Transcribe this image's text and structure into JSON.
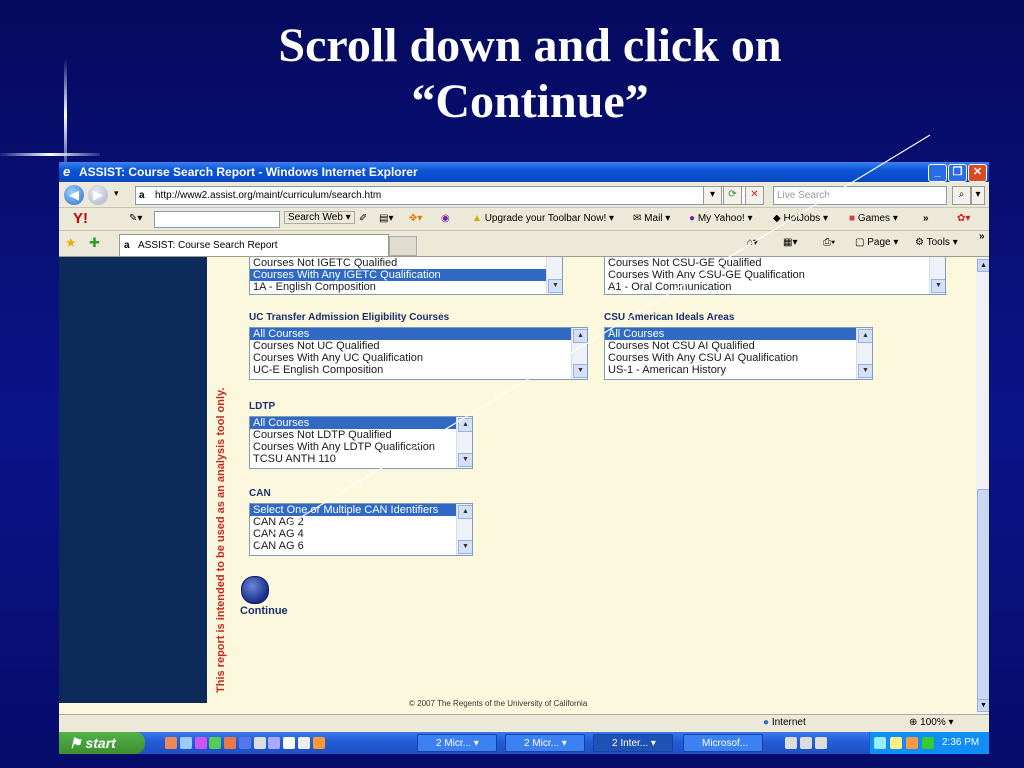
{
  "slide": {
    "title_line1": "Scroll down and click on",
    "title_line2": "“Continue”"
  },
  "browser": {
    "window_title": "ASSIST: Course Search Report - Windows Internet Explorer",
    "url": "http://www2.assist.org/maint/curriculum/search.htm",
    "search_placeholder": "Live Search",
    "toolbar": {
      "yahoo_logo": "Y!",
      "search_web": "Search Web",
      "upgrade": "Upgrade your Toolbar Now!",
      "mail": "Mail",
      "my_yahoo": "My Yahoo!",
      "hotjobs": "HotJobs",
      "games": "Games",
      "more": "»"
    },
    "tab_label": "ASSIST: Course Search Report",
    "commandbar": {
      "page": "Page",
      "tools": "Tools",
      "more": "»"
    }
  },
  "content": {
    "side_note": "This report is intended to be used as an analysis tool only.",
    "listboxes": {
      "igetc_partial": [
        "Courses Not IGETC Qualified",
        "Courses With Any IGETC Qualification",
        "1A - English Composition"
      ],
      "csu_ge_partial": [
        "Courses Not CSU-GE Qualified",
        "Courses With Any CSU-GE Qualification",
        "A1 - Oral Communication"
      ],
      "uc_transfer": {
        "label": "UC Transfer Admission Eligibility Courses",
        "options": [
          "All Courses",
          "Courses Not UC Qualified",
          "Courses With Any UC Qualification",
          "UC-E English Composition"
        ]
      },
      "csu_ai": {
        "label": "CSU American Ideals Areas",
        "options": [
          "All Courses",
          "Courses Not CSU AI Qualified",
          "Courses With Any CSU AI Qualification",
          "US-1 - American History"
        ]
      },
      "ldtp": {
        "label": "LDTP",
        "options": [
          "All Courses",
          "Courses Not LDTP Qualified",
          "Courses With Any LDTP Qualification",
          "TCSU ANTH 110"
        ]
      },
      "can": {
        "label": "CAN",
        "options": [
          "Select One or Multiple CAN Identifiers",
          "CAN AG 2",
          "CAN AG 4",
          "CAN AG 6"
        ]
      }
    },
    "continue_label": "Continue",
    "footer": "© 2007 The Regents of the University of California"
  },
  "statusbar": {
    "zone": "Internet",
    "zoom": "100%"
  },
  "taskbar": {
    "start": "start",
    "items": [
      "2 Micr...",
      "2 Micr...",
      "2 Inter...",
      "Microsof..."
    ],
    "clock": "2:36 PM"
  }
}
